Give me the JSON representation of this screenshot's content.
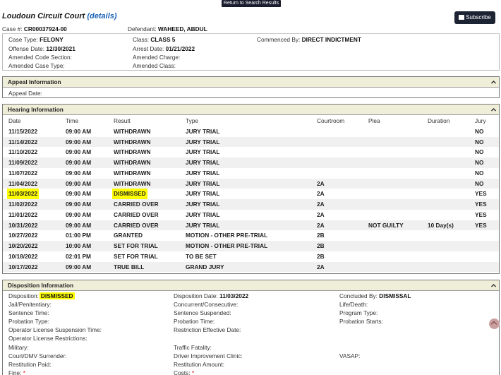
{
  "top_button": "Return to Search Results",
  "header": {
    "court": "Loudoun Circuit Court",
    "details_link": "(details)",
    "subscribe_label": "Subscribe",
    "case_num_label": "Case #:",
    "case_num": "CR00037924-00",
    "defendant_label": "Defendant:",
    "defendant": "WAHEED, ABDUL"
  },
  "case": {
    "case_type_label": "Case Type:",
    "case_type": "FELONY",
    "class_label": "Class:",
    "class": "CLASS 5",
    "commenced_label": "Commenced By:",
    "commenced": "DIRECT INDICTMENT",
    "offense_date_label": "Offense Date:",
    "offense_date": "12/30/2021",
    "arrest_date_label": "Arrest Date:",
    "arrest_date": "01/21/2022",
    "amended_code_label": "Amended Code Section:",
    "amended_charge_label": "Amended Charge:",
    "amended_type_label": "Amended Case Type:",
    "amended_class_label": "Amended Class:"
  },
  "appeal": {
    "title": "Appeal Information",
    "appeal_date_label": "Appeal Date:"
  },
  "hearing": {
    "title": "Hearing Information",
    "columns": [
      "Date",
      "Time",
      "Result",
      "Type",
      "Courtroom",
      "Plea",
      "Duration",
      "Jury"
    ],
    "rows": [
      {
        "date": "11/15/2022",
        "time": "09:00 AM",
        "result": "WITHDRAWN",
        "type": "JURY TRIAL",
        "courtroom": "",
        "plea": "",
        "duration": "",
        "jury": "NO"
      },
      {
        "date": "11/14/2022",
        "time": "09:00 AM",
        "result": "WITHDRAWN",
        "type": "JURY TRIAL",
        "courtroom": "",
        "plea": "",
        "duration": "",
        "jury": "NO"
      },
      {
        "date": "11/10/2022",
        "time": "09:00 AM",
        "result": "WITHDRAWN",
        "type": "JURY TRIAL",
        "courtroom": "",
        "plea": "",
        "duration": "",
        "jury": "NO"
      },
      {
        "date": "11/09/2022",
        "time": "09:00 AM",
        "result": "WITHDRAWN",
        "type": "JURY TRIAL",
        "courtroom": "",
        "plea": "",
        "duration": "",
        "jury": "NO"
      },
      {
        "date": "11/07/2022",
        "time": "09:00 AM",
        "result": "WITHDRAWN",
        "type": "JURY TRIAL",
        "courtroom": "",
        "plea": "",
        "duration": "",
        "jury": "NO"
      },
      {
        "date": "11/04/2022",
        "time": "09:00 AM",
        "result": "WITHDRAWN",
        "type": "JURY TRIAL",
        "courtroom": "2A",
        "plea": "",
        "duration": "",
        "jury": "NO"
      },
      {
        "date": "11/03/2022",
        "time": "09:00 AM",
        "result": "DISMISSED",
        "type": "JURY TRIAL",
        "courtroom": "2A",
        "plea": "",
        "duration": "",
        "jury": "YES"
      },
      {
        "date": "11/02/2022",
        "time": "09:00 AM",
        "result": "CARRIED OVER",
        "type": "JURY TRIAL",
        "courtroom": "2A",
        "plea": "",
        "duration": "",
        "jury": "YES"
      },
      {
        "date": "11/01/2022",
        "time": "09:00 AM",
        "result": "CARRIED OVER",
        "type": "JURY TRIAL",
        "courtroom": "2A",
        "plea": "",
        "duration": "",
        "jury": "YES"
      },
      {
        "date": "10/31/2022",
        "time": "09:00 AM",
        "result": "CARRIED OVER",
        "type": "JURY TRIAL",
        "courtroom": "2A",
        "plea": "NOT GUILTY",
        "duration": "10 Day(s)",
        "jury": "YES"
      },
      {
        "date": "10/27/2022",
        "time": "01:00 PM",
        "result": "GRANTED",
        "type": "MOTION - OTHER PRE-TRIAL",
        "courtroom": "2B",
        "plea": "",
        "duration": "",
        "jury": ""
      },
      {
        "date": "10/20/2022",
        "time": "10:00 AM",
        "result": "SET FOR TRIAL",
        "type": "MOTION - OTHER PRE-TRIAL",
        "courtroom": "2B",
        "plea": "",
        "duration": "",
        "jury": ""
      },
      {
        "date": "10/18/2022",
        "time": "02:01 PM",
        "result": "SET FOR TRIAL",
        "type": "TO BE SET",
        "courtroom": "2B",
        "plea": "",
        "duration": "",
        "jury": ""
      },
      {
        "date": "10/17/2022",
        "time": "09:00 AM",
        "result": "TRUE BILL",
        "type": "GRAND JURY",
        "courtroom": "2A",
        "plea": "",
        "duration": "",
        "jury": ""
      }
    ]
  },
  "disposition": {
    "title": "Disposition Information",
    "disposition_label": "Disposition:",
    "disposition": "DISMISSED",
    "disposition_date_label": "Disposition Date:",
    "disposition_date": "11/03/2022",
    "concluded_label": "Concluded By:",
    "concluded": "DISMISSAL",
    "jail_label": "Jail/Penitentiary:",
    "concurrent_label": "Concurrent/Consecutive:",
    "life_label": "Life/Death:",
    "sentence_time_label": "Sentence Time:",
    "sentence_susp_label": "Sentence Suspended:",
    "program_type_label": "Program Type:",
    "probation_type_label": "Probation Type:",
    "probation_time_label": "Probation Time:",
    "probation_starts_label": "Probation Starts:",
    "ol_susp_time_label": "Operator License Suspension Time:",
    "restriction_eff_label": "Restriction Effective Date:",
    "ol_restrictions_label": "Operator License Restrictions:",
    "military_label": "Military:",
    "traffic_fatality_label": "Traffic Fatality:",
    "court_dmv_label": "Court/DMV Surrender:",
    "driver_improvement_label": "Driver Improvement Clinic:",
    "vasap_label": "VASAP:",
    "restitution_paid_label": "Restitution Paid:",
    "restitution_amount_label": "Restitution Amount:",
    "fine_label": "Fine:",
    "costs_label": "Costs:",
    "required_mark": "*"
  },
  "colors": {
    "panel_header_bg": "#efeed8",
    "highlight": "#ffff00",
    "link": "#1a63b8",
    "button_dark": "#1c2333"
  }
}
